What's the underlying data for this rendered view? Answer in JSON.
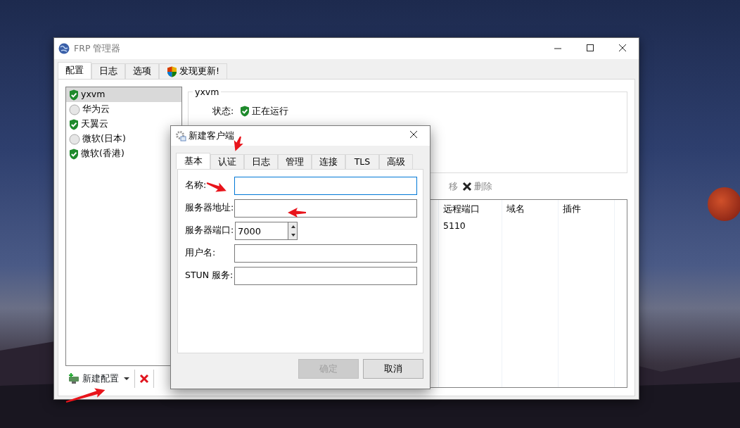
{
  "window": {
    "title": "FRP 管理器"
  },
  "tabs": [
    {
      "label": "配置",
      "selected": true,
      "kind": "plain"
    },
    {
      "label": "日志",
      "selected": false,
      "kind": "plain"
    },
    {
      "label": "选项",
      "selected": false,
      "kind": "plain"
    },
    {
      "label": "发现更新!",
      "selected": false,
      "kind": "update"
    }
  ],
  "configs": [
    {
      "name": "yxvm",
      "running": true,
      "selected": true
    },
    {
      "name": "华为云",
      "running": false,
      "selected": false
    },
    {
      "name": "天翼云",
      "running": true,
      "selected": false
    },
    {
      "name": "微软(日本)",
      "running": false,
      "selected": false
    },
    {
      "name": "微软(香港)",
      "running": true,
      "selected": false
    }
  ],
  "config_toolbar": {
    "new_label": "新建配置"
  },
  "detail": {
    "group_title": "yxvm",
    "status_label": "状态:",
    "status_text": "正在运行",
    "running": true
  },
  "proxy_toolbar": [
    {
      "label": "移",
      "kind": "cut",
      "disabled": true
    },
    {
      "label": "删除",
      "kind": "delete",
      "disabled": true
    }
  ],
  "table": {
    "columns": [
      "远程端口",
      "域名",
      "插件"
    ],
    "rows": [
      [
        "5110"
      ]
    ]
  },
  "dialog": {
    "title": "新建客户端",
    "tabs": [
      {
        "label": "基本",
        "selected": true
      },
      {
        "label": "认证",
        "selected": false
      },
      {
        "label": "日志",
        "selected": false
      },
      {
        "label": "管理",
        "selected": false
      },
      {
        "label": "连接",
        "selected": false
      },
      {
        "label": "TLS",
        "selected": false
      },
      {
        "label": "高级",
        "selected": false
      }
    ],
    "fields": [
      {
        "label": "名称:",
        "kind": "text",
        "focused": true
      },
      {
        "label": "服务器地址:",
        "kind": "text",
        "focused": false
      },
      {
        "label": "服务器端口:",
        "kind": "spin",
        "value": "7000",
        "focused": false
      },
      {
        "label": "用户名:",
        "kind": "text",
        "focused": false
      },
      {
        "label": "STUN 服务:",
        "kind": "text",
        "focused": false
      }
    ],
    "buttons": [
      {
        "label": "确定",
        "disabled": true
      },
      {
        "label": "取消",
        "disabled": false
      }
    ]
  }
}
